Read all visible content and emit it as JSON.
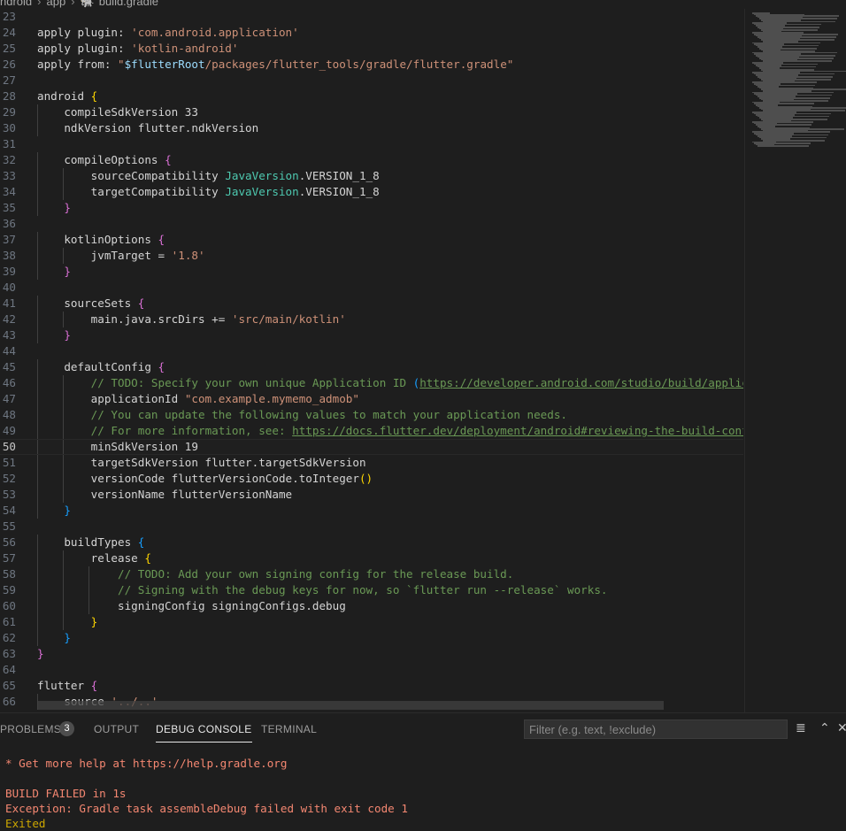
{
  "breadcrumb": {
    "items": [
      "ndroid",
      "app",
      "build.gradle"
    ]
  },
  "editor": {
    "current_line": "50",
    "lines": [
      {
        "n": "23",
        "code": ""
      },
      {
        "n": "24",
        "code": "apply plugin: 'com.android.application'"
      },
      {
        "n": "25",
        "code": "apply plugin: 'kotlin-android'"
      },
      {
        "n": "26",
        "code": "apply from: \"$flutterRoot/packages/flutter_tools/gradle/flutter.gradle\""
      },
      {
        "n": "27",
        "code": ""
      },
      {
        "n": "28",
        "code": "android {"
      },
      {
        "n": "29",
        "code": "    compileSdkVersion 33"
      },
      {
        "n": "30",
        "code": "    ndkVersion flutter.ndkVersion"
      },
      {
        "n": "31",
        "code": ""
      },
      {
        "n": "32",
        "code": "    compileOptions {"
      },
      {
        "n": "33",
        "code": "        sourceCompatibility JavaVersion.VERSION_1_8"
      },
      {
        "n": "34",
        "code": "        targetCompatibility JavaVersion.VERSION_1_8"
      },
      {
        "n": "35",
        "code": "    }"
      },
      {
        "n": "36",
        "code": ""
      },
      {
        "n": "37",
        "code": "    kotlinOptions {"
      },
      {
        "n": "38",
        "code": "        jvmTarget = '1.8'"
      },
      {
        "n": "39",
        "code": "    }"
      },
      {
        "n": "40",
        "code": ""
      },
      {
        "n": "41",
        "code": "    sourceSets {"
      },
      {
        "n": "42",
        "code": "        main.java.srcDirs += 'src/main/kotlin'"
      },
      {
        "n": "43",
        "code": "    }"
      },
      {
        "n": "44",
        "code": ""
      },
      {
        "n": "45",
        "code": "    defaultConfig {"
      },
      {
        "n": "46",
        "code": "        // TODO: Specify your own unique Application ID (https://developer.android.com/studio/build/application"
      },
      {
        "n": "47",
        "code": "        applicationId \"com.example.mymemo_admob\""
      },
      {
        "n": "48",
        "code": "        // You can update the following values to match your application needs."
      },
      {
        "n": "49",
        "code": "        // For more information, see: https://docs.flutter.dev/deployment/android#reviewing-the-build-configura"
      },
      {
        "n": "50",
        "code": "        minSdkVersion 19"
      },
      {
        "n": "51",
        "code": "        targetSdkVersion flutter.targetSdkVersion"
      },
      {
        "n": "52",
        "code": "        versionCode flutterVersionCode.toInteger()"
      },
      {
        "n": "53",
        "code": "        versionName flutterVersionName"
      },
      {
        "n": "54",
        "code": "    }"
      },
      {
        "n": "55",
        "code": ""
      },
      {
        "n": "56",
        "code": "    buildTypes {"
      },
      {
        "n": "57",
        "code": "        release {"
      },
      {
        "n": "58",
        "code": "            // TODO: Add your own signing config for the release build."
      },
      {
        "n": "59",
        "code": "            // Signing with the debug keys for now, so `flutter run --release` works."
      },
      {
        "n": "60",
        "code": "            signingConfig signingConfigs.debug"
      },
      {
        "n": "61",
        "code": "        }"
      },
      {
        "n": "62",
        "code": "    }"
      },
      {
        "n": "63",
        "code": "}"
      },
      {
        "n": "64",
        "code": ""
      },
      {
        "n": "65",
        "code": "flutter {"
      },
      {
        "n": "66",
        "code": "    source '../..'"
      }
    ]
  },
  "panel": {
    "tabs": [
      {
        "label": "PROBLEMS",
        "badge": "3",
        "active": false
      },
      {
        "label": "OUTPUT",
        "active": false
      },
      {
        "label": "DEBUG CONSOLE",
        "active": true
      },
      {
        "label": "TERMINAL",
        "active": false
      }
    ],
    "filter_placeholder": "Filter (e.g. text, !exclude)"
  },
  "console": {
    "lines": [
      {
        "text": "* Get more help at https://help.gradle.org",
        "kind": "error"
      },
      {
        "text": "",
        "kind": "blank"
      },
      {
        "text": "BUILD FAILED in 1s",
        "kind": "error"
      },
      {
        "text": "Exception: Gradle task assembleDebug failed with exit code 1",
        "kind": "error"
      },
      {
        "text": "Exited",
        "kind": "warning"
      }
    ]
  },
  "colors": {
    "string": "#ce9178",
    "variable": "#9cdcfe",
    "type": "#4ec9b0",
    "comment": "#6a9955",
    "bracket1": "#ffd700",
    "bracket2": "#da70d6",
    "bracket3": "#179fff",
    "error": "#f48771",
    "warning": "#cca700"
  }
}
